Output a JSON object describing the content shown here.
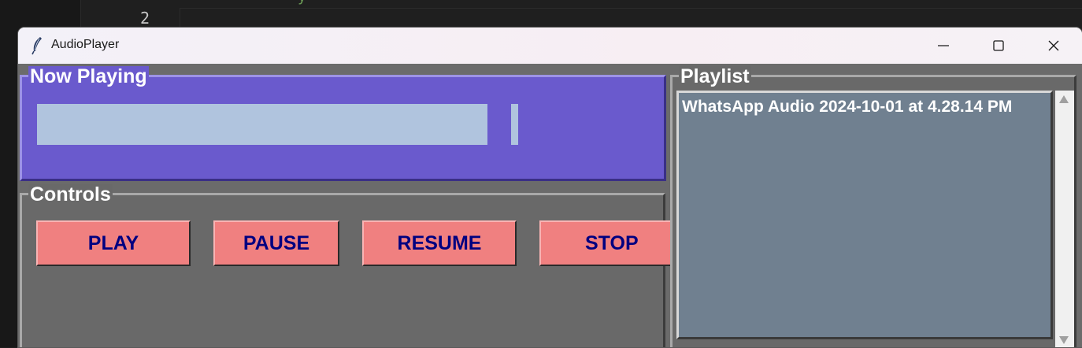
{
  "editor": {
    "line_number": "2"
  },
  "window": {
    "title": "AudioPlayer",
    "icon": "feather-icon",
    "controls": [
      "minimize-icon",
      "maximize-icon",
      "close-icon"
    ]
  },
  "now_playing": {
    "label": "Now Playing",
    "status_text": ""
  },
  "controls": {
    "label": "Controls",
    "play": "PLAY",
    "pause": "PAUSE",
    "resume": "RESUME",
    "stop": "STOP"
  },
  "playlist": {
    "label": "Playlist",
    "items": [
      "WhatsApp Audio 2024-10-01 at 4.28.14 PM"
    ]
  },
  "colors": {
    "now_playing_bg": "#6a5acd",
    "status_field": "#b0c4de",
    "panel_bg": "#696969",
    "button_bg": "#f08080",
    "button_text": "#000080",
    "listbox_bg": "#708090"
  }
}
